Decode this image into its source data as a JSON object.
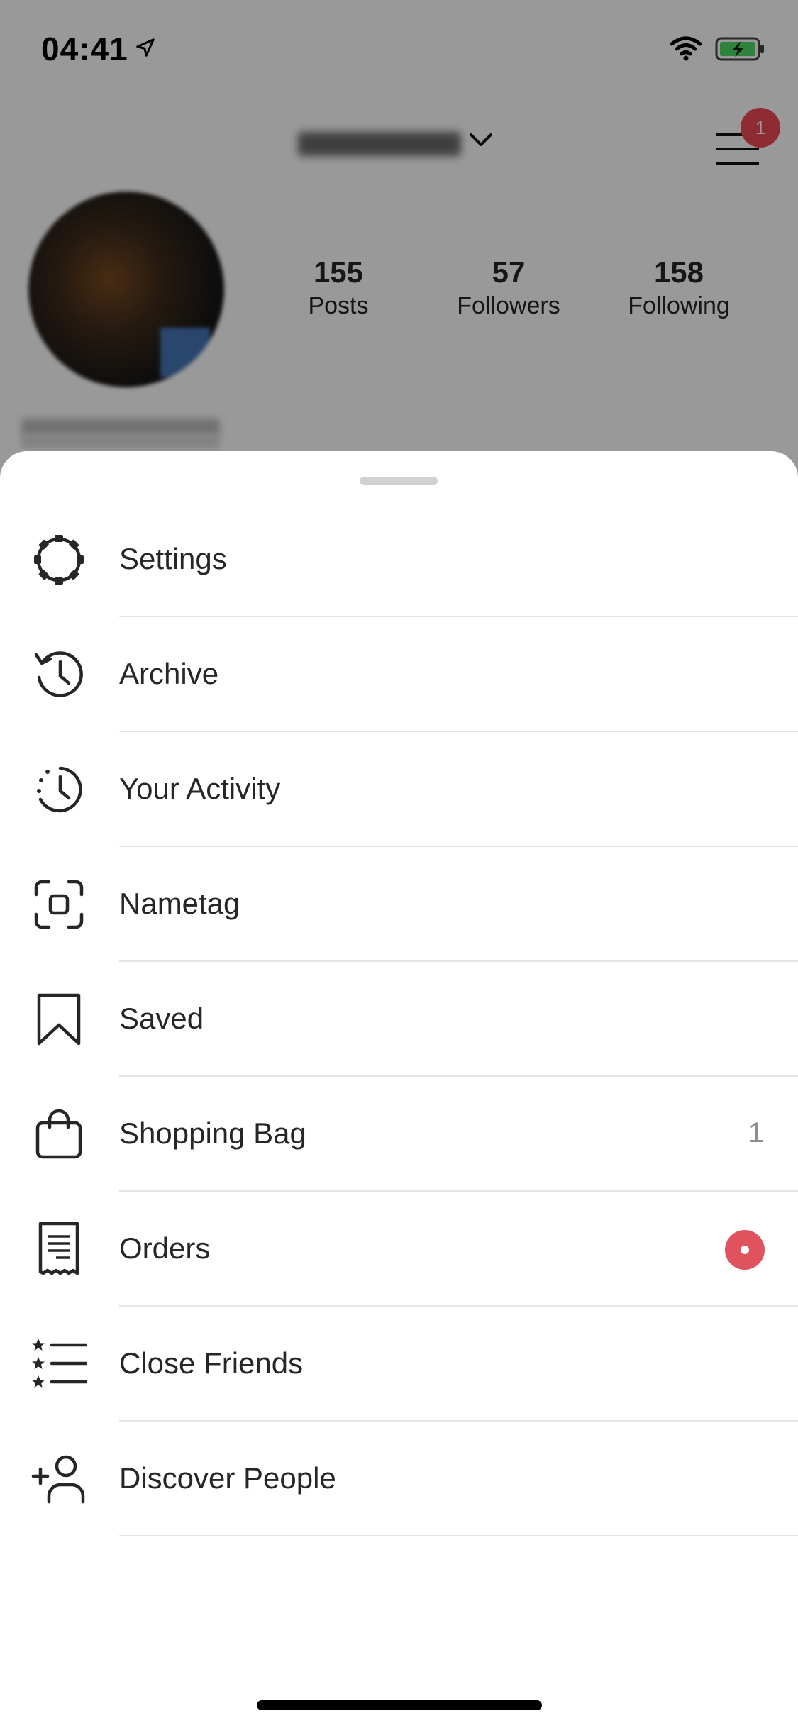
{
  "status_bar": {
    "time": "04:41",
    "location_icon": "location-arrow-icon",
    "wifi_icon": "wifi-icon",
    "battery_icon": "battery-charging-icon",
    "battery_color": "#4cd964"
  },
  "profile": {
    "notification_count": "1",
    "stats": [
      {
        "value": "155",
        "label": "Posts"
      },
      {
        "value": "57",
        "label": "Followers"
      },
      {
        "value": "158",
        "label": "Following"
      }
    ]
  },
  "menu": {
    "items": [
      {
        "label": "Settings",
        "icon": "settings-icon"
      },
      {
        "label": "Archive",
        "icon": "archive-icon"
      },
      {
        "label": "Your Activity",
        "icon": "activity-icon"
      },
      {
        "label": "Nametag",
        "icon": "nametag-icon"
      },
      {
        "label": "Saved",
        "icon": "bookmark-icon"
      },
      {
        "label": "Shopping Bag",
        "icon": "shopping-bag-icon",
        "count": "1"
      },
      {
        "label": "Orders",
        "icon": "receipt-icon",
        "badge_color": "#e0525d"
      },
      {
        "label": "Close Friends",
        "icon": "close-friends-icon"
      },
      {
        "label": "Discover People",
        "icon": "add-person-icon"
      }
    ]
  },
  "colors": {
    "accent_red": "#ed4956",
    "text": "#262626",
    "muted": "#8e8e8e",
    "divider": "#e6e6e6"
  }
}
